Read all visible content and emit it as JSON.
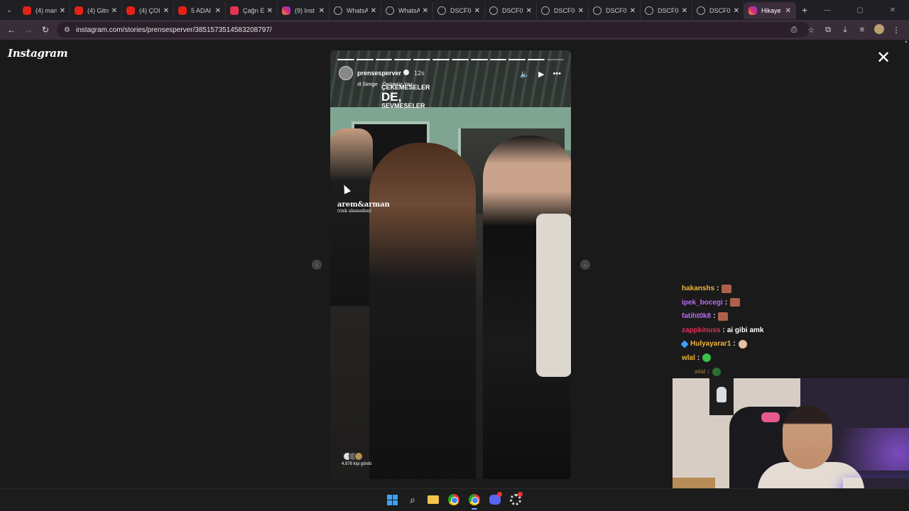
{
  "browser": {
    "tabs": [
      {
        "title": "(4) man",
        "icon": "youtube-icon"
      },
      {
        "title": "(4) Gitn",
        "icon": "youtube-icon"
      },
      {
        "title": "(4) ÇOI",
        "icon": "youtube-icon"
      },
      {
        "title": "5 ADAI",
        "icon": "youtube-icon"
      },
      {
        "title": "Çağrı E",
        "icon": "music-icon"
      },
      {
        "title": "(9) Inst",
        "icon": "instagram-icon"
      },
      {
        "title": "WhatsA",
        "icon": "globe-icon"
      },
      {
        "title": "WhatsA",
        "icon": "globe-icon"
      },
      {
        "title": "DSCF0",
        "icon": "globe-icon"
      },
      {
        "title": "DSCF0",
        "icon": "globe-icon"
      },
      {
        "title": "DSCF0",
        "icon": "globe-icon"
      },
      {
        "title": "DSCF0",
        "icon": "globe-icon"
      },
      {
        "title": "DSCF0",
        "icon": "globe-icon"
      },
      {
        "title": "DSCF0",
        "icon": "globe-icon"
      },
      {
        "title": "Hikaye",
        "icon": "instagram-icon",
        "active": true
      }
    ],
    "new_tab": "+",
    "url": "instagram.com/stories/prensesperver/3851573514583208797/"
  },
  "instagram": {
    "logo": "Instagram",
    "story": {
      "username": "prensesperver",
      "time": "12s",
      "song": "Simge · Önümüz Yaz",
      "overlay_line1": "ÇEKEMESELER",
      "overlay_line2": "DE,",
      "overlay_line3": "SEVMESELER",
      "sticker_title": "arem&arman",
      "sticker_sub": "(risk alamadım)",
      "viewers_text": "4.978 kişi gördü",
      "segments_total": 12,
      "segments_seen": 11
    }
  },
  "chat": [
    {
      "user": "hakanshs",
      "color": "#f0b43c",
      "text": "",
      "emote": "#b0604a"
    },
    {
      "user": "ipek_bocegi",
      "color": "#b86cf0",
      "text": "",
      "emote": "#b0604a"
    },
    {
      "user": "fatiht0k8",
      "color": "#b86cf0",
      "text": "",
      "emote": "#b0604a"
    },
    {
      "user": "zappkinuss",
      "color": "#e0305a",
      "text": "ai gibi amk",
      "emote": ""
    },
    {
      "user": "Hulyayarar1",
      "color": "#f0b43c",
      "text": "",
      "emote": "#e8c0a0",
      "badge": true
    },
    {
      "user": "wlal",
      "color": "#f0b43c",
      "text": "",
      "emote": "#3cc24a"
    }
  ],
  "chat_faded": {
    "user": "wlal",
    "emote": "#3cc24a"
  }
}
